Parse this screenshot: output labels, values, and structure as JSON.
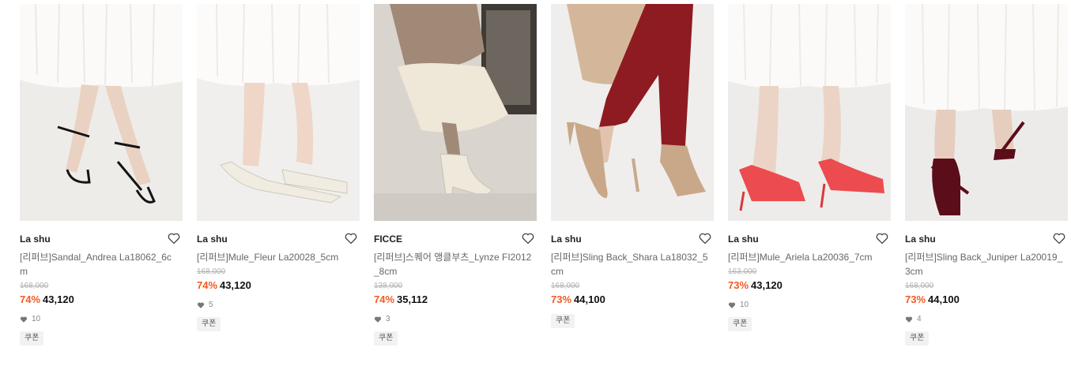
{
  "products": [
    {
      "brand": "La shu",
      "name": "[리퍼브]Sandal_Andrea La18062_6cm",
      "original_price": "168,000",
      "discount": "74%",
      "sale_price": "43,120",
      "likes": "10",
      "badge": "쿠폰",
      "colors": {
        "bg": "#eeece9",
        "skirt": "#fbfaf8",
        "leg": "#e9d2c2",
        "shoe": "#141414"
      }
    },
    {
      "brand": "La shu",
      "name": "[리퍼브]Mule_Fleur La20028_5cm",
      "original_price": "168,000",
      "discount": "74%",
      "sale_price": "43,120",
      "likes": "5",
      "badge": "쿠폰",
      "colors": {
        "bg": "#f0efed",
        "skirt": "#fcfbf9",
        "leg": "#efd6c6",
        "shoe": "#f1ece1"
      }
    },
    {
      "brand": "FICCE",
      "name": "[리퍼브]스퀘어 앵클부츠_Lynze FI2012_8cm",
      "original_price": "138,000",
      "discount": "74%",
      "sale_price": "35,112",
      "likes": "3",
      "badge": "쿠폰",
      "colors": {
        "bg": "#d9d5ce",
        "skirt": "#efe7d7",
        "leg": "#a08977",
        "shoe": "#efe9dc"
      }
    },
    {
      "brand": "La shu",
      "name": "[리퍼브]Sling Back_Shara La18032_5cm",
      "original_price": "168,000",
      "discount": "73%",
      "sale_price": "44,100",
      "likes": "",
      "badge": "쿠폰",
      "colors": {
        "bg": "#efeeec",
        "skirt": "#d4b79a",
        "leg": "#8e1b22",
        "shoe": "#c9a88a"
      }
    },
    {
      "brand": "La shu",
      "name": "[리퍼브]Mule_Ariela La20036_7cm",
      "original_price": "163,000",
      "discount": "73%",
      "sale_price": "43,120",
      "likes": "10",
      "badge": "쿠폰",
      "colors": {
        "bg": "#eeecea",
        "skirt": "#fbfaf8",
        "leg": "#ebd4c6",
        "shoe": "#ec4b4f"
      }
    },
    {
      "brand": "La shu",
      "name": "[리퍼브]Sling Back_Juniper La20019_3cm",
      "original_price": "168,000",
      "discount": "73%",
      "sale_price": "44,100",
      "likes": "4",
      "badge": "쿠폰",
      "colors": {
        "bg": "#ecebea",
        "skirt": "#fbfaf8",
        "leg": "#e6cdbd",
        "shoe": "#5b0d1a"
      }
    }
  ],
  "icons": {
    "wishlist": "heart-outline-icon",
    "likes": "heart-filled-icon"
  }
}
